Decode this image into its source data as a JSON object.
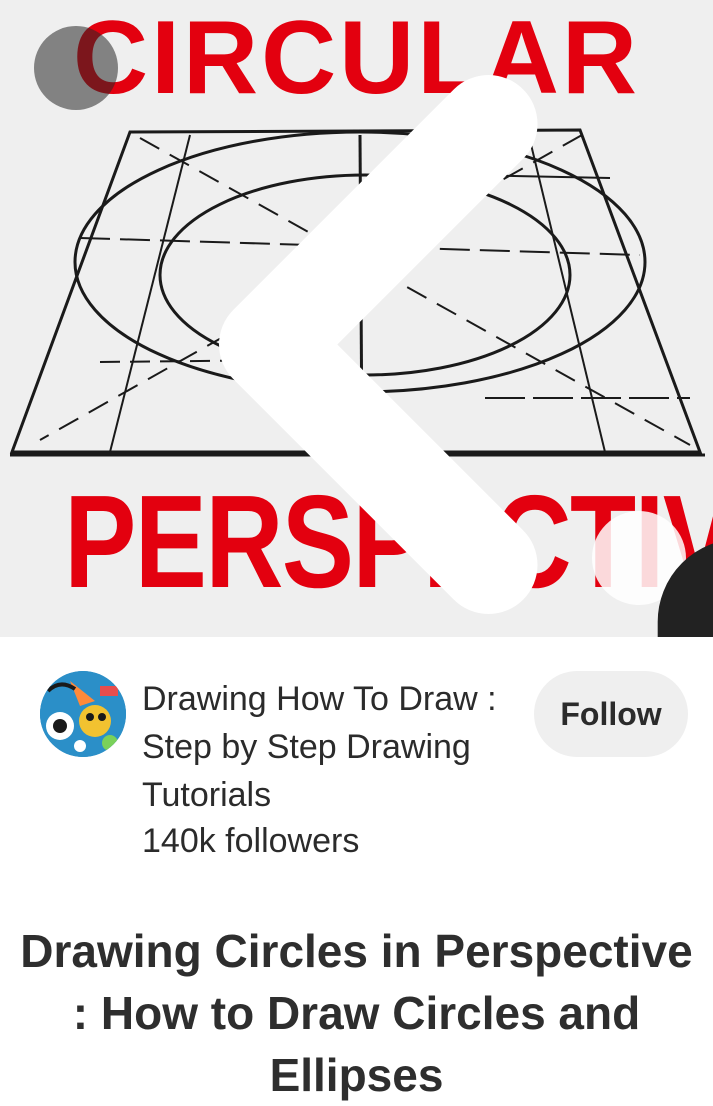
{
  "pin_image": {
    "title_top": "CIRCULAR",
    "title_bottom": "PERSPECTIVE",
    "accent_color": "#e3000f"
  },
  "nav": {
    "back_icon": "chevron-left-icon",
    "visual_search_icon": "lens-search-icon"
  },
  "creator": {
    "name": "Drawing How To Draw : Step by Step Drawing Tutorials",
    "followers": "140k followers",
    "follow_label": "Follow"
  },
  "pin": {
    "title": "Drawing Circles in Perspective : How to Draw Circles and Ellipses"
  }
}
